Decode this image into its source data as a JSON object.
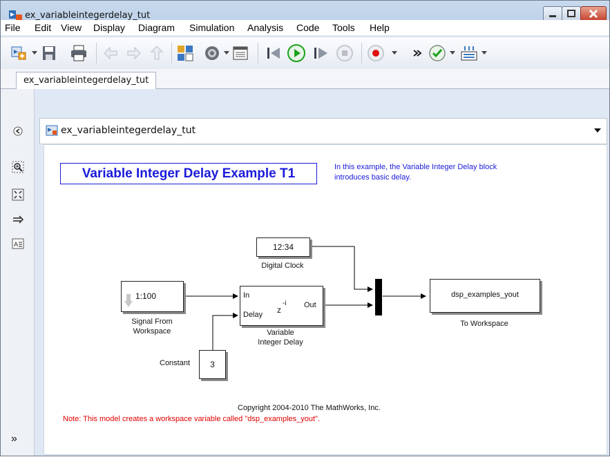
{
  "window": {
    "title": "ex_variableintegerdelay_tut",
    "tab": "ex_variableintegerdelay_tut",
    "address": "ex_variableintegerdelay_tut"
  },
  "menu": [
    "File",
    "Edit",
    "View",
    "Display",
    "Diagram",
    "Simulation",
    "Analysis",
    "Code",
    "Tools",
    "Help"
  ],
  "toolbar": {
    "icons": [
      "new-model-icon",
      "save-icon",
      "print-icon",
      "back-icon",
      "forward-icon",
      "up-icon",
      "library-browser-icon",
      "settings-icon",
      "model-explorer-icon",
      "step-back-icon",
      "run-icon",
      "step-forward-icon",
      "stop-icon",
      "record-icon",
      "overflow-icon",
      "check-icon",
      "build-icon"
    ]
  },
  "left_toolbar": {
    "icons": [
      "hide-browser-icon",
      "zoom-icon",
      "fit-view-icon",
      "arrow-icon",
      "annotation-icon",
      "expand-icon"
    ],
    "expand_label": "»"
  },
  "diagram": {
    "title": "Variable Integer Delay Example T1",
    "description_line1": "In this example, the Variable Integer Delay block",
    "description_line2": "introduces basic delay.",
    "note": "Note: This model creates a workspace variable called \"dsp_examples_yout\".",
    "copyright": "Copyright 2004-2010 The MathWorks, Inc.",
    "blocks": {
      "digital_clock": {
        "value": "12:34",
        "label": "Digital Clock"
      },
      "signal_from_workspace": {
        "value": "1:100",
        "label_line1": "Signal From",
        "label_line2": "Workspace"
      },
      "variable_integer_delay": {
        "port_in": "In",
        "port_delay": "Delay",
        "port_out": "Out",
        "symbol": "z",
        "exponent": "-i",
        "label_line1": "Variable",
        "label_line2": "Integer Delay"
      },
      "constant": {
        "value": "3",
        "label": "Constant"
      },
      "to_workspace": {
        "value": "dsp_examples_yout",
        "label": "To Workspace"
      }
    }
  },
  "colors": {
    "title_blue": "#1a1adb",
    "note_red": "#e00000",
    "run_green": "#1aa11a",
    "record_red": "#e01010"
  }
}
